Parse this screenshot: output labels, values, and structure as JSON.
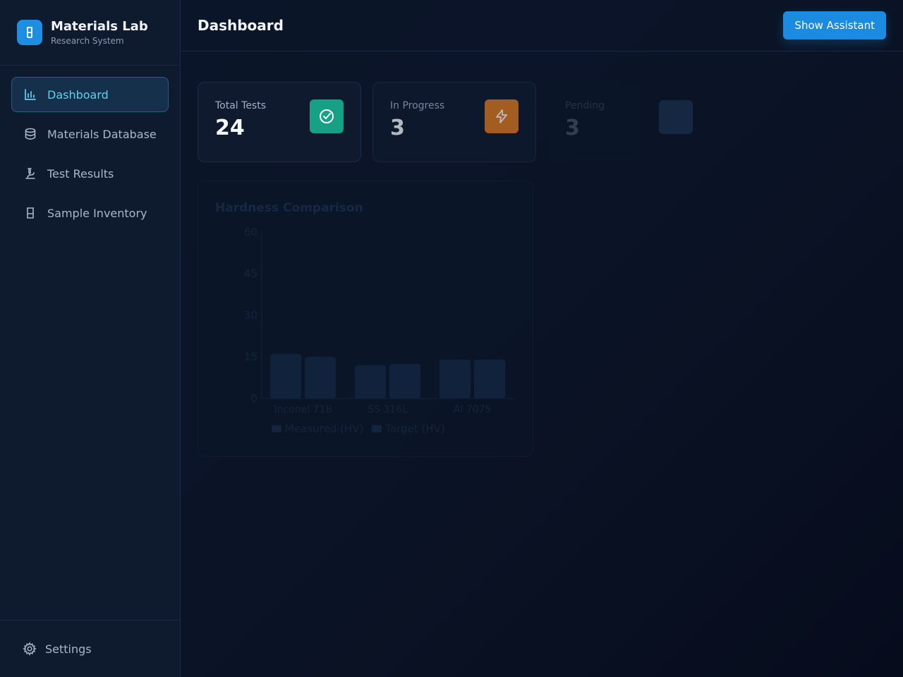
{
  "brand": {
    "title": "Materials Lab",
    "subtitle": "Research System",
    "icon": "beaker-icon"
  },
  "nav": {
    "items": [
      {
        "label": "Dashboard",
        "icon": "bar-chart-icon",
        "active": true
      },
      {
        "label": "Materials Database",
        "icon": "database-icon",
        "active": false
      },
      {
        "label": "Test Results",
        "icon": "microscope-icon",
        "active": false
      },
      {
        "label": "Sample Inventory",
        "icon": "beaker-icon",
        "active": false
      }
    ],
    "settings_label": "Settings"
  },
  "header": {
    "title": "Dashboard",
    "assistant_button": "Show Assistant"
  },
  "stats": [
    {
      "label": "Total Tests",
      "value": "24",
      "icon": "check-circle-icon",
      "color": "#16a085"
    },
    {
      "label": "In Progress",
      "value": "3",
      "icon": "lightning-icon",
      "color": "#e07a1f"
    },
    {
      "label": "Pending",
      "value": "3",
      "icon": "clock-icon",
      "color": "#2b4a73"
    }
  ],
  "chart": {
    "title": "Hardness Comparison"
  },
  "chart_data": {
    "type": "bar",
    "title": "Hardness Comparison",
    "categories": [
      "Inconel 718",
      "SS 316L",
      "Al 7075"
    ],
    "series": [
      {
        "name": "Measured (HV)",
        "values": [
          16,
          12,
          14
        ]
      },
      {
        "name": "Target (HV)",
        "values": [
          15,
          12.5,
          14
        ]
      }
    ],
    "yticks": [
      "0",
      "15",
      "30",
      "45",
      "60"
    ],
    "ylim": [
      0,
      60
    ],
    "legend": "bottom",
    "grid": false
  }
}
